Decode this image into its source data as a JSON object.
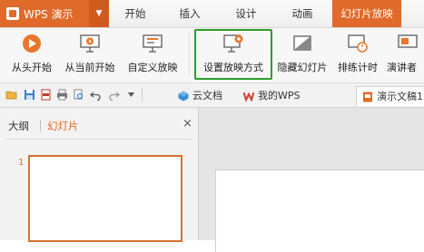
{
  "app": {
    "title": "WPS 演示",
    "dropdown": "▼"
  },
  "menu": {
    "tabs": [
      {
        "label": "开始",
        "active": false
      },
      {
        "label": "插入",
        "active": false
      },
      {
        "label": "设计",
        "active": false
      },
      {
        "label": "动画",
        "active": false
      },
      {
        "label": "幻灯片放映",
        "active": true
      }
    ]
  },
  "ribbon": {
    "buttons": [
      {
        "label": "从头开始",
        "icon": "play-circle-icon"
      },
      {
        "label": "从当前开始",
        "icon": "projector-play-icon"
      },
      {
        "label": "自定义放映",
        "icon": "projector-screen-icon"
      },
      {
        "label": "设置放映方式",
        "icon": "projector-settings-icon",
        "highlighted": true
      },
      {
        "label": "隐藏幻灯片",
        "icon": "hide-slide-icon"
      },
      {
        "label": "排练计时",
        "icon": "rehearse-timing-icon"
      },
      {
        "label": "演讲者",
        "icon": "presenter-view-icon"
      }
    ]
  },
  "toolbar": {
    "icons": [
      "open-folder-icon",
      "save-icon",
      "export-pdf-icon",
      "print-icon",
      "print-preview-icon",
      "undo-icon",
      "redo-icon",
      "more-dropdown-icon"
    ],
    "doc_tabs": [
      {
        "label": "云文档",
        "icon": "cloud-cube-icon",
        "active": false
      },
      {
        "label": "我的WPS",
        "icon": "wps-logo-icon",
        "active": false
      },
      {
        "label": "演示文稿1",
        "icon": "presentation-doc-icon",
        "active": true
      }
    ]
  },
  "left_panel": {
    "tabs": [
      {
        "label": "大纲",
        "active": false
      },
      {
        "label": "幻灯片",
        "active": true
      }
    ],
    "close": "×",
    "slide_number": "1"
  },
  "colors": {
    "accent": "#e06a2a",
    "highlight_box": "#2e9b2e",
    "thumbnail_border": "#d9702f"
  }
}
